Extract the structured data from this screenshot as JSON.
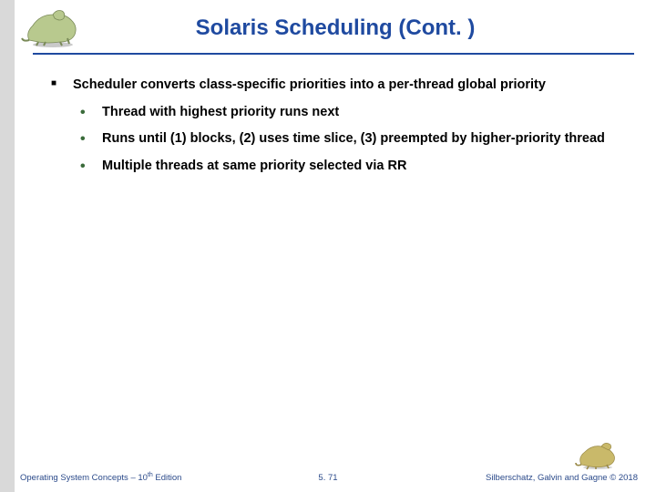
{
  "header": {
    "title": "Solaris Scheduling (Cont. )"
  },
  "body": {
    "bullet1": "Scheduler converts class-specific priorities into a per-thread global priority",
    "sub1": "Thread with highest priority runs next",
    "sub2": "Runs until (1) blocks, (2) uses time slice, (3) preempted by higher-priority thread",
    "sub3": "Multiple threads at same priority selected via RR"
  },
  "footer": {
    "left_prefix": "Operating System Concepts – 10",
    "left_suffix": " Edition",
    "left_sup": "th",
    "center": "5. 71",
    "right": "Silberschatz, Galvin and Gagne © 2018"
  }
}
